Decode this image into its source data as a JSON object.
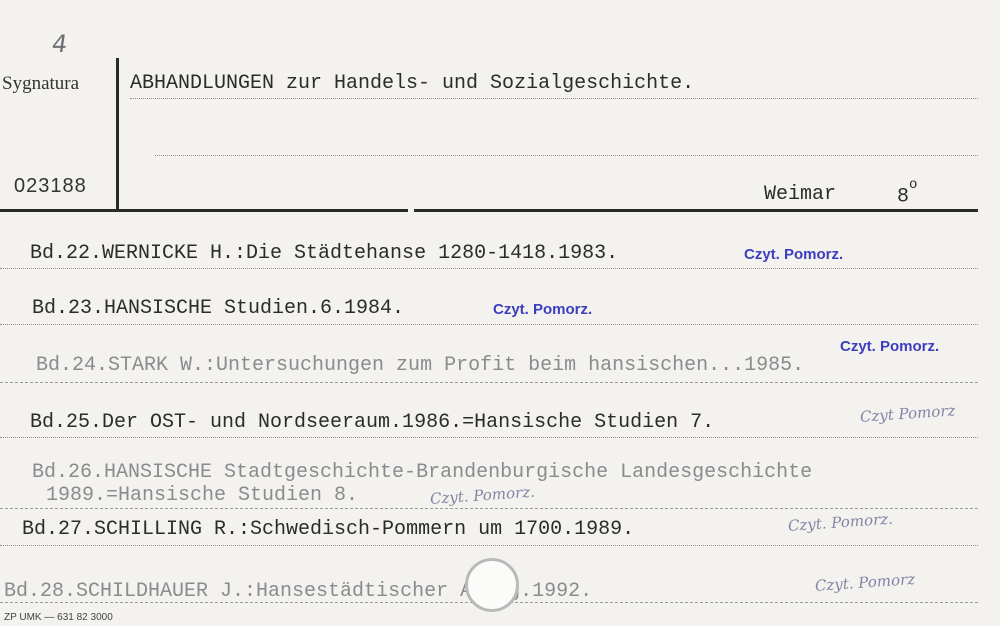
{
  "card": {
    "corner_number": "4",
    "signature_label": "Sygnatura",
    "signature_number": "023188",
    "title": "ABHANDLUNGEN zur Handels- und Sozialgeschichte.",
    "place": "Weimar",
    "format": "8",
    "format_sup": "o",
    "printer_note": "ZP UMK — 631 82 3000"
  },
  "entries": [
    {
      "text": "Bd.22.WERNICKE H.:Die Städtehanse 1280-1418.1983.",
      "note": "Czyt. Pomorz."
    },
    {
      "text": "Bd.23.HANSISCHE Studien.6.1984.",
      "note": "Czyt. Pomorz."
    },
    {
      "text": "Bd.24.STARK W.:Untersuchungen zum Profit beim hansischen...1985.",
      "note": "Czyt. Pomorz."
    },
    {
      "text": "Bd.25.Der OST- und Nordseeraum.1986.=Hansische Studien 7.",
      "note": "Czyt Pomorz"
    },
    {
      "text": "Bd.26.HANSISCHE Stadtgeschichte-Brandenburgische Landesgeschichte",
      "text2": "1989.=Hansische Studien 8.",
      "note": "Czyt. Pomorz."
    },
    {
      "text": "Bd.27.SCHILLING R.:Schwedisch-Pommern um 1700.1989.",
      "note": "Czyt. Pomorz."
    },
    {
      "text": "Bd.28.SCHILDHAUER J.:Hansestädtischer Altag.1992.",
      "note": "Czyt. Pomorz"
    }
  ]
}
